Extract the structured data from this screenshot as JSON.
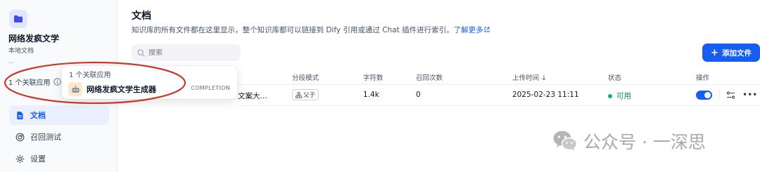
{
  "sidebar": {
    "kb_name": "网络发疯文学",
    "kb_type": "本地文档",
    "kb_description": "--",
    "related_apps_label": "1 个关联应用",
    "nav": [
      {
        "label": "文档",
        "icon": "document-icon",
        "active": true
      },
      {
        "label": "召回测试",
        "icon": "target-icon",
        "active": false
      },
      {
        "label": "设置",
        "icon": "gear-icon",
        "active": false
      }
    ]
  },
  "popover": {
    "title": "1 个关联应用",
    "app_name": "网络发疯文学生成器",
    "app_mode": "COMPLETION"
  },
  "main": {
    "title": "文档",
    "description": "知识库的所有文件都在这里显示，整个知识库都可以链接到 Dify 引用或通过 Chat 插件进行索引。",
    "learn_more": "了解更多",
    "search_placeholder": "搜索",
    "add_button": "添加文件"
  },
  "table": {
    "headers": {
      "segment_mode": "分段模式",
      "char_count": "字符数",
      "recall_count": "召回次数",
      "upload_time": "上传时间 ↓",
      "status": "状态",
      "actions": "操作"
    },
    "rows": [
      {
        "name": "文案大…",
        "segment_mode": "父子",
        "char_count": "1.4k",
        "recall_count": "0",
        "upload_time": "2025-02-23 11:11",
        "status": "可用"
      }
    ]
  },
  "colors": {
    "accent": "#155eef",
    "status_green": "#17b26a",
    "annotation_red": "#c8382b"
  },
  "watermark": {
    "text": "公众号 · 一深思"
  }
}
